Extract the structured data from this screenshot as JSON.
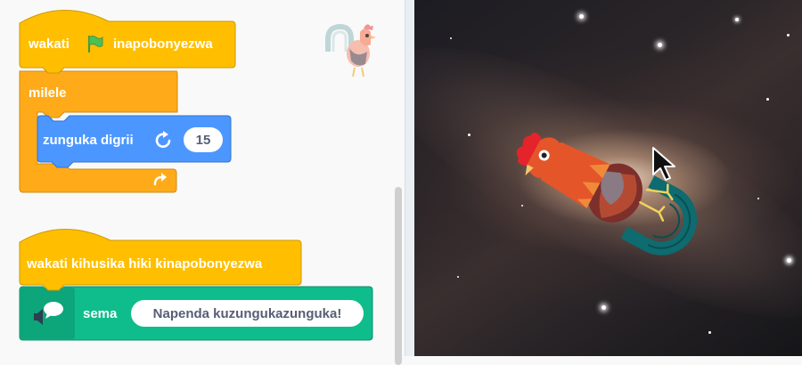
{
  "code_area": {
    "script1": {
      "hat_prefix": "wakati",
      "hat_icon": "green-flag-icon",
      "hat_suffix": "inapobonyezwa",
      "loop_label": "milele",
      "loop_icon": "loop-arrow-icon",
      "turn_label": "zunguka digrii",
      "turn_icon": "rotate-clockwise-icon",
      "turn_value": "15"
    },
    "script2": {
      "hat_label": "wakati kihusika hiki kinapobonyezwa",
      "say_icon": "text-to-speech-icon",
      "say_label": "sema",
      "say_value": "Napenda kuzungukazunguka!"
    },
    "sprite_icon": "rooster-sprite-icon"
  },
  "stage": {
    "backdrop": "galaxy",
    "sprite": "rooster-sprite",
    "cursor": "mouse-pointer-icon"
  },
  "colors": {
    "events": "#ffbf00",
    "control": "#ffab19",
    "motion": "#4c97ff",
    "extension": "#0fbd8c",
    "text_gray": "#575e75"
  }
}
